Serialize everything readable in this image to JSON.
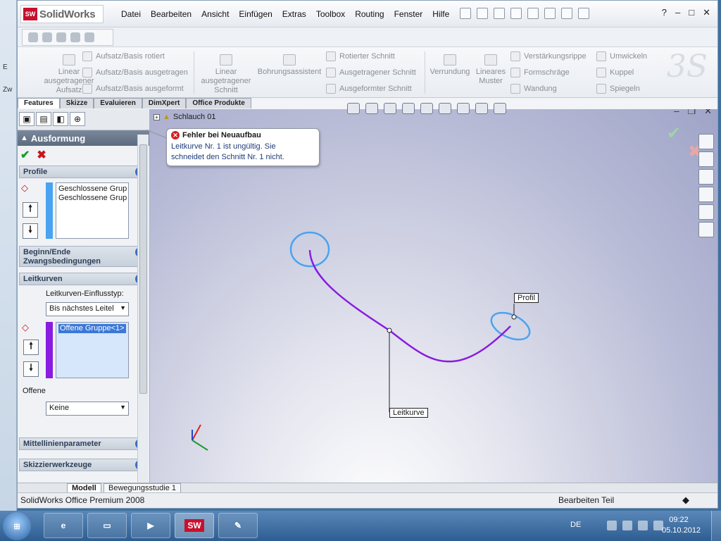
{
  "desktop": {
    "side_letters": [
      "E",
      "Zw"
    ]
  },
  "app": {
    "logo_text": "SolidWorks",
    "logo_mark": "SW",
    "menu": [
      "Datei",
      "Bearbeiten",
      "Ansicht",
      "Einfügen",
      "Extras",
      "Toolbox",
      "Routing",
      "Fenster",
      "Hilfe"
    ],
    "window_controls": {
      "help": "?",
      "minimize": "–",
      "restore": "□",
      "close": "✕"
    }
  },
  "command_manager": {
    "linear_aufsatz": "Linear ausgetragener Aufsatz",
    "aufsatz_rotiert": "Aufsatz/Basis rotiert",
    "aufsatz_ausgetragen": "Aufsatz/Basis ausgetragen",
    "aufsatz_ausgeformt": "Aufsatz/Basis ausgeformt",
    "linear_schnitt": "Linear ausgetragener Schnitt",
    "bohrungsassistent": "Bohrungsassistent",
    "rotierter_schnitt": "Rotierter Schnitt",
    "ausgetragener_schnitt": "Ausgetragener Schnitt",
    "ausgeformter_schnitt": "Ausgeformter Schnitt",
    "verrundung": "Verrundung",
    "lineares_muster": "Lineares Muster",
    "verstaerkungsrippe": "Verstärkungsrippe",
    "formschraege": "Formschräge",
    "wandung": "Wandung",
    "umwickeln": "Umwickeln",
    "kuppel": "Kuppel",
    "spiegeln": "Spiegeln"
  },
  "tabs": [
    "Features",
    "Skizze",
    "Evaluieren",
    "DimXpert",
    "Office Produkte"
  ],
  "property_manager": {
    "title": "Ausformung",
    "help": "?",
    "profile_header": "Profile",
    "profile_items": [
      "Geschlossene Grup",
      "Geschlossene Grup"
    ],
    "constraints_header": "Beginn/Ende Zwangsbedingungen",
    "guides_header": "Leitkurven",
    "influence_label": "Leitkurven-Einflusstyp:",
    "influence_value": "Bis nächstes Leitel",
    "guide_items": [
      "Offene Gruppe<1>"
    ],
    "offene_label": "Offene",
    "offene_value": "Keine",
    "centerline_header": "Mittellinienparameter",
    "sketchtools_header": "Skizzierwerkzeuge",
    "colors": {
      "profile_bar": "#4aa3f0",
      "guide_bar": "#8a1be0"
    }
  },
  "graphics": {
    "tree_item": "Schlauch 01",
    "label_profil": "Profil",
    "label_leitkurve": "Leitkurve",
    "colors": {
      "guide_curve": "#8a1be0",
      "profile_ellipse": "#4aa3f0"
    }
  },
  "error_bubble": {
    "title": "Fehler bei Neuaufbau",
    "line1": "Leitkurve Nr. 1 ist ungültig. Sie",
    "line2": "schneidet den Schnitt Nr. 1  nicht."
  },
  "model_tabs": [
    "Modell",
    "Bewegungsstudie 1"
  ],
  "status": {
    "left": "SolidWorks Office Premium 2008",
    "right": "Bearbeiten Teil"
  },
  "taskbar": {
    "start": "⊞",
    "app_label": "SW",
    "lang": "DE",
    "time": "09:22",
    "date": "05.10.2012"
  }
}
